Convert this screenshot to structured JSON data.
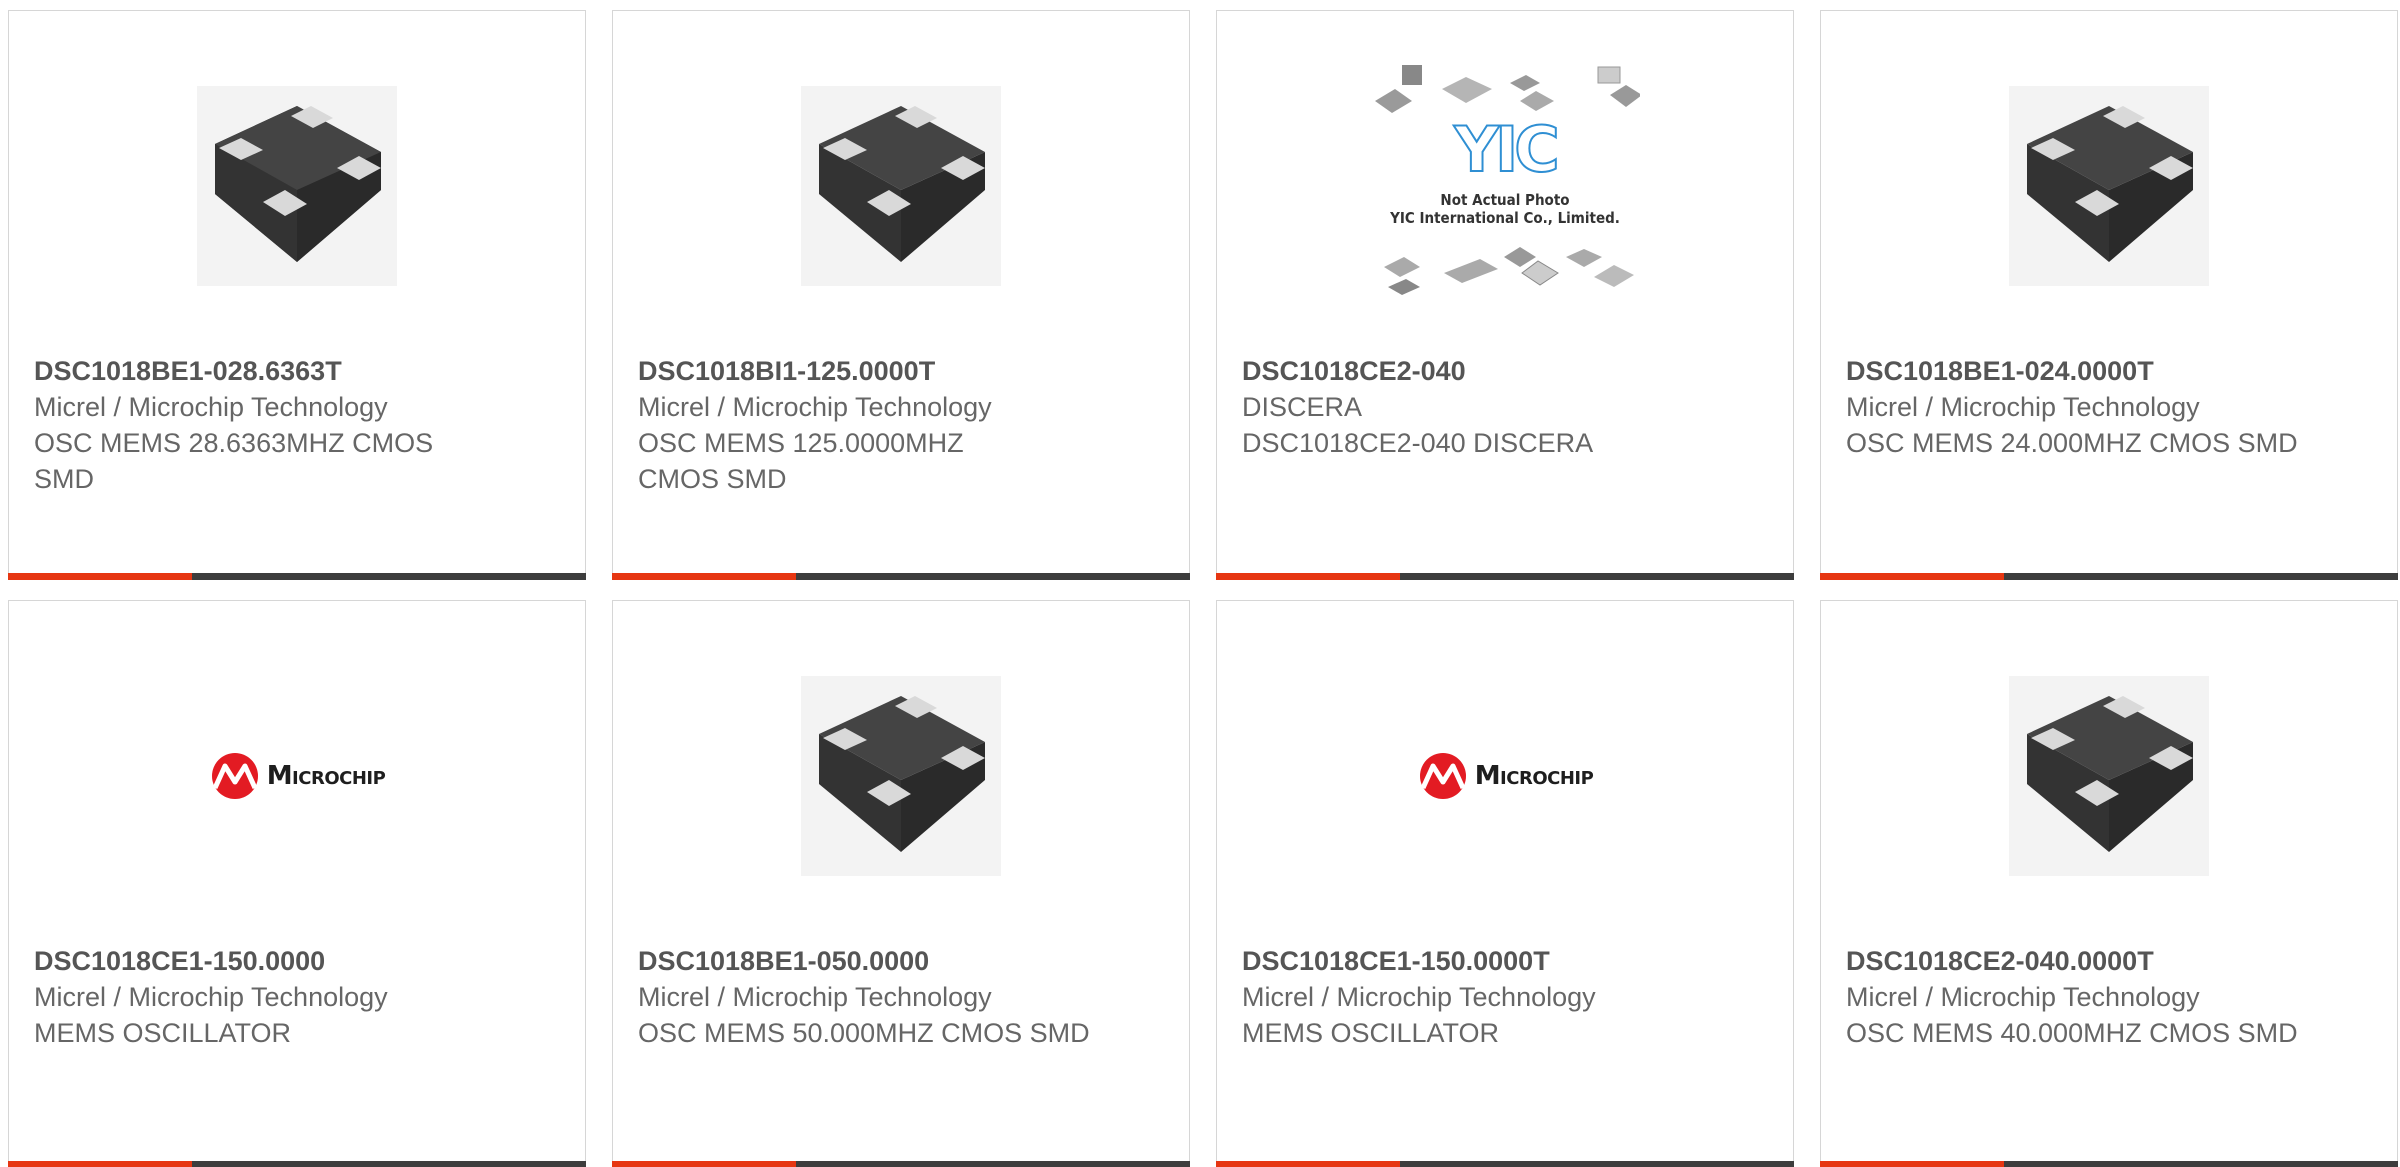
{
  "products": [
    {
      "part_number": "DSC1018BE1-028.6363T",
      "manufacturer": "Micrel / Microchip Technology",
      "description": "OSC MEMS 28.6363MHZ CMOS SMD",
      "image": "chip-package-image"
    },
    {
      "part_number": "DSC1018BI1-125.0000T",
      "manufacturer": "Micrel / Microchip Technology",
      "description": "OSC MEMS 125.0000MHZ CMOS SMD",
      "image": "chip-package-image"
    },
    {
      "part_number": "DSC1018CE2-040",
      "manufacturer": "DISCERA",
      "description": "DSC1018CE2-040 DISCERA",
      "image": "not-actual-photo-placeholder",
      "image_text": {
        "logo": "YIC",
        "line1": "Not Actual Photo",
        "line2": "YIC International Co., Limited."
      }
    },
    {
      "part_number": "DSC1018BE1-024.0000T",
      "manufacturer": "Micrel / Microchip Technology",
      "description": "OSC MEMS 24.000MHZ CMOS SMD",
      "image": "chip-package-image"
    },
    {
      "part_number": "DSC1018CE1-150.0000",
      "manufacturer": "Micrel / Microchip Technology",
      "description": "MEMS OSCILLATOR",
      "image": "microchip-logo",
      "image_text": {
        "logo": "Microchip"
      }
    },
    {
      "part_number": "DSC1018BE1-050.0000",
      "manufacturer": "Micrel / Microchip Technology",
      "description": "OSC MEMS 50.000MHZ CMOS SMD",
      "image": "chip-package-image"
    },
    {
      "part_number": "DSC1018CE1-150.0000T",
      "manufacturer": "Micrel / Microchip Technology",
      "description": "MEMS OSCILLATOR",
      "image": "microchip-logo",
      "image_text": {
        "logo": "Microchip"
      }
    },
    {
      "part_number": "DSC1018CE2-040.0000T",
      "manufacturer": "Micrel / Microchip Technology",
      "description": "OSC MEMS 40.000MHZ CMOS SMD",
      "image": "chip-package-image"
    }
  ],
  "colors": {
    "accent": "#e63612",
    "bar": "#3d3d3d",
    "text": "#666666",
    "border": "#d6d6d6"
  }
}
